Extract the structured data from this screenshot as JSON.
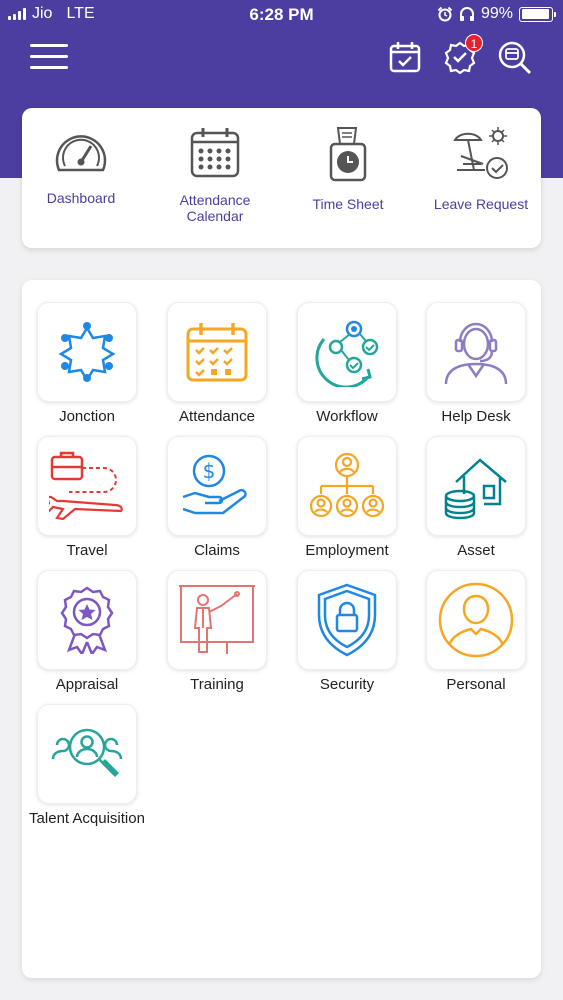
{
  "status_bar": {
    "carrier": "Jio",
    "network": "LTE",
    "time": "6:28 PM",
    "battery": "99%"
  },
  "header": {
    "notification_count": "1",
    "icons": [
      "menu-icon",
      "calendar-check-icon",
      "verified-badge-icon",
      "search-icon"
    ]
  },
  "quick_links": [
    {
      "label": "Dashboard",
      "icon": "speedometer-icon"
    },
    {
      "label": "Attendance Calendar",
      "icon": "calendar-icon"
    },
    {
      "label": "Time Sheet",
      "icon": "timesheet-icon"
    },
    {
      "label": "Leave Request",
      "icon": "beach-chair-icon"
    }
  ],
  "modules": [
    {
      "label": "Jonction",
      "icon": "people-network-icon"
    },
    {
      "label": "Attendance",
      "icon": "attendance-calendar-icon"
    },
    {
      "label": "Workflow",
      "icon": "workflow-icon"
    },
    {
      "label": "Help Desk",
      "icon": "headset-agent-icon"
    },
    {
      "label": "Travel",
      "icon": "travel-icon"
    },
    {
      "label": "Claims",
      "icon": "money-hand-icon"
    },
    {
      "label": "Employment",
      "icon": "org-chart-icon"
    },
    {
      "label": "Asset",
      "icon": "house-coins-icon"
    },
    {
      "label": "Appraisal",
      "icon": "award-ribbon-icon"
    },
    {
      "label": "Training",
      "icon": "presentation-icon"
    },
    {
      "label": "Security",
      "icon": "shield-lock-icon"
    },
    {
      "label": "Personal",
      "icon": "person-circle-icon"
    },
    {
      "label": "Talent Acquisition",
      "icon": "talent-search-icon"
    }
  ],
  "colors": {
    "header": "#4c3ea0",
    "accent_label": "#4c3ea0",
    "badge": "#e5202e"
  }
}
